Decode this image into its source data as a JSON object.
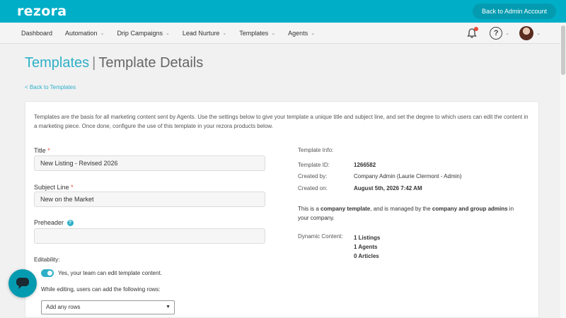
{
  "brand": {
    "logo": "rezora",
    "accent": "#00aec7"
  },
  "topbar": {
    "back_admin": "Back to Admin Account"
  },
  "nav": {
    "items": [
      {
        "label": "Dashboard",
        "has_menu": false
      },
      {
        "label": "Automation",
        "has_menu": true
      },
      {
        "label": "Drip Campaigns",
        "has_menu": true
      },
      {
        "label": "Lead Nurture",
        "has_menu": true
      },
      {
        "label": "Templates",
        "has_menu": true
      },
      {
        "label": "Agents",
        "has_menu": true
      }
    ],
    "help_symbol": "?",
    "icons": [
      "bell-icon",
      "help-icon",
      "avatar"
    ]
  },
  "page": {
    "breadcrumb_link": "Templates",
    "separator": "|",
    "title": "Template Details",
    "back_link": "< Back to Templates"
  },
  "intro": "Templates are the basis for all marketing content sent by Agents. Use the settings below to give your template a unique title and subject line, and set the degree to which users can edit the content in a marketing piece. Once done, configure the use of this template in your rezora products below.",
  "form": {
    "title_label": "Title",
    "title_value": "New Listing - Revised 2026",
    "subject_label": "Subject Line",
    "subject_value": "New on the Market",
    "preheader_label": "Preheader",
    "preheader_value": "",
    "required_mark": "*",
    "editability_label": "Editability:",
    "toggle_label": "Yes, your team can edit template content.",
    "toggle_on": true,
    "rows_label": "While editing, users can add the following rows:",
    "rows_select": "Add any rows"
  },
  "info": {
    "title": "Template Info:",
    "id_key": "Template ID:",
    "id_value": "1266582",
    "created_by_key": "Created by:",
    "created_by_value": "Company Admin (Laurie Clermont - Admin)",
    "created_on_key": "Created on:",
    "created_on_value": "August 5th, 2026 7:42 AM",
    "note_prefix": "This is a ",
    "note_bold1": "company template",
    "note_mid": ", and is managed by the ",
    "note_bold2": "company and group admins",
    "note_suffix": " in your company.",
    "dynamic_key": "Dynamic Content:",
    "dynamic_items": [
      "1 Listings",
      "1 Agents",
      "0 Articles"
    ]
  }
}
